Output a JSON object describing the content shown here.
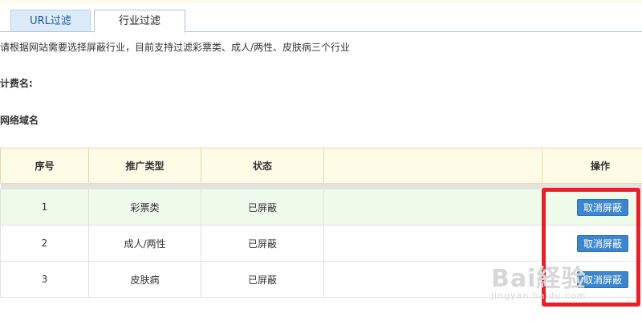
{
  "tabs": [
    {
      "label": "URL过滤",
      "active": false
    },
    {
      "label": "行业过滤",
      "active": true
    }
  ],
  "description": "请根据网站需要选择屏蔽行业，目前支持过滤彩票类、成人/两性、皮肤病三个行业",
  "fee_name_label": "计费名:",
  "domain_label": "网络域名",
  "table": {
    "headers": {
      "index": "序号",
      "type": "推广类型",
      "status": "状态",
      "blank": "",
      "action": "操作"
    },
    "rows": [
      {
        "index": "1",
        "type": "彩票类",
        "status": "已屏蔽",
        "action": "取消屏蔽"
      },
      {
        "index": "2",
        "type": "成人/两性",
        "status": "已屏蔽",
        "action": "取消屏蔽"
      },
      {
        "index": "3",
        "type": "皮肤病",
        "status": "已屏蔽",
        "action": "取消屏蔽"
      }
    ]
  },
  "watermark": {
    "logo": "Bai経验",
    "url": "jingyan.baidu.com"
  },
  "colors": {
    "highlight": "#e8202a",
    "button": "#3c86d0",
    "header_bg": "#fefbe6"
  }
}
